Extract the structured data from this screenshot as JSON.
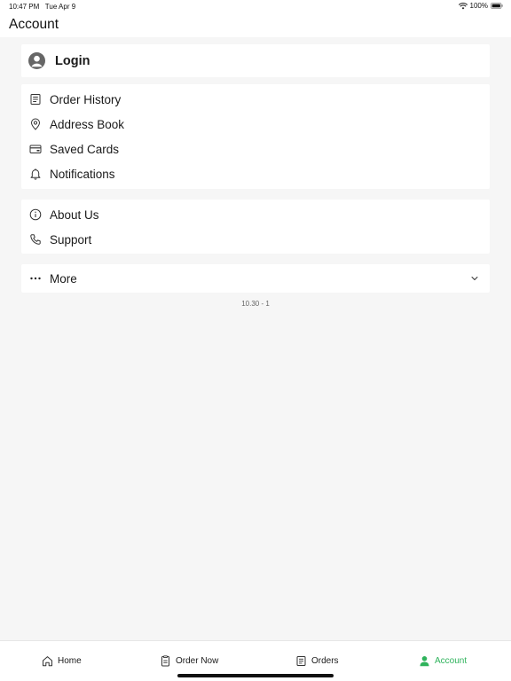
{
  "status_bar": {
    "time": "10:47 PM",
    "date": "Tue Apr 9",
    "battery": "100%"
  },
  "header": {
    "title": "Account"
  },
  "login": {
    "label": "Login"
  },
  "menu": {
    "order_history": "Order History",
    "address_book": "Address Book",
    "saved_cards": "Saved Cards",
    "notifications": "Notifications"
  },
  "info": {
    "about_us": "About Us",
    "support": "Support"
  },
  "more": {
    "label": "More"
  },
  "version": "10.30 - 1",
  "tabbar": {
    "home": "Home",
    "order_now": "Order Now",
    "orders": "Orders",
    "account": "Account"
  },
  "colors": {
    "accent": "#2fb35c",
    "background": "#f6f6f6"
  }
}
